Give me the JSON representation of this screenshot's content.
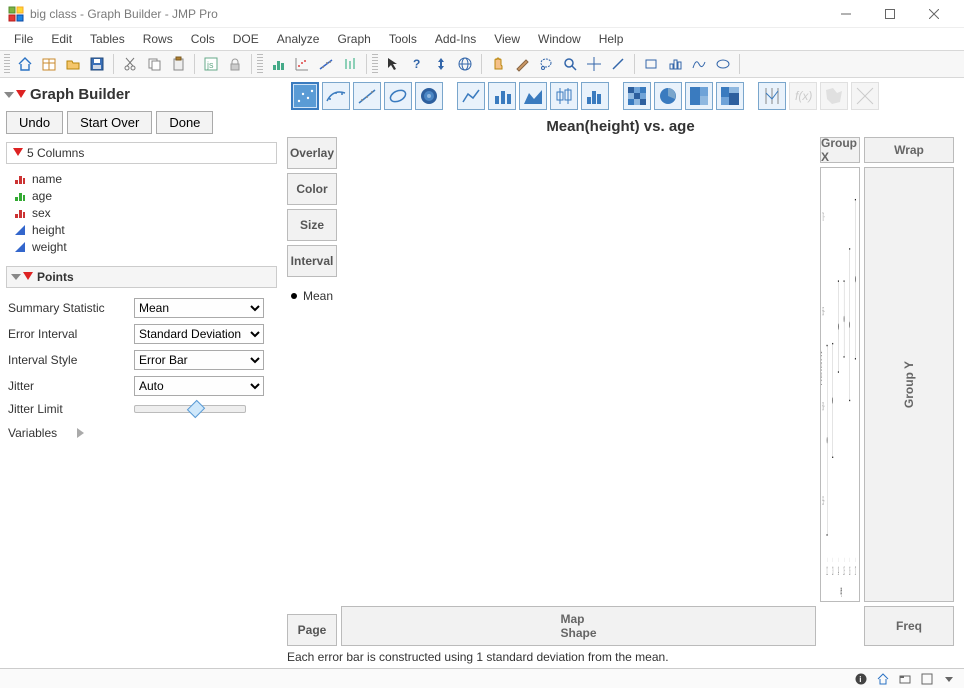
{
  "window": {
    "title": "big class - Graph Builder - JMP Pro"
  },
  "menu": [
    "File",
    "Edit",
    "Tables",
    "Rows",
    "Cols",
    "DOE",
    "Analyze",
    "Graph",
    "Tools",
    "Add-Ins",
    "View",
    "Window",
    "Help"
  ],
  "section_title": "Graph Builder",
  "buttons": {
    "undo": "Undo",
    "start_over": "Start Over",
    "done": "Done"
  },
  "columns_header": "5 Columns",
  "columns": [
    {
      "name": "name",
      "icon": "nominal-red"
    },
    {
      "name": "age",
      "icon": "ordinal-green"
    },
    {
      "name": "sex",
      "icon": "nominal-red"
    },
    {
      "name": "height",
      "icon": "continuous-blue"
    },
    {
      "name": "weight",
      "icon": "continuous-blue"
    }
  ],
  "points_header": "Points",
  "form": {
    "summary_label": "Summary Statistic",
    "summary_value": "Mean",
    "error_label": "Error Interval",
    "error_value": "Standard Deviation",
    "style_label": "Interval Style",
    "style_value": "Error Bar",
    "jitter_label": "Jitter",
    "jitter_value": "Auto",
    "jlimit_label": "Jitter Limit",
    "vars_label": "Variables"
  },
  "chart": {
    "title": "Mean(height) vs. age",
    "groupx": "Group X",
    "wrap": "Wrap",
    "groupy": "Group Y",
    "mapshape": "Map\nShape",
    "freq": "Freq",
    "overlay": "Overlay",
    "color": "Color",
    "size": "Size",
    "interval": "Interval",
    "page": "Page",
    "legend_item": "Mean",
    "xlabel": "age",
    "ylabel": "height",
    "footnote": "Each error bar is constructed using 1 standard deviation from the mean."
  },
  "chart_data": {
    "type": "scatter",
    "title": "Mean(height) vs. age",
    "xlabel": "age",
    "ylabel": "height",
    "x": [
      12,
      13,
      14,
      15,
      16,
      17
    ],
    "y": [
      58.2,
      60.3,
      64.2,
      64.6,
      64.3,
      66.7
    ],
    "err": [
      5.0,
      3.0,
      2.4,
      2.0,
      4.0,
      4.2
    ],
    "ylim": [
      52,
      72
    ],
    "ytick": [
      55,
      60,
      65,
      70
    ],
    "legend": [
      "Mean"
    ],
    "note": "Each error bar is constructed using 1 standard deviation from the mean."
  }
}
